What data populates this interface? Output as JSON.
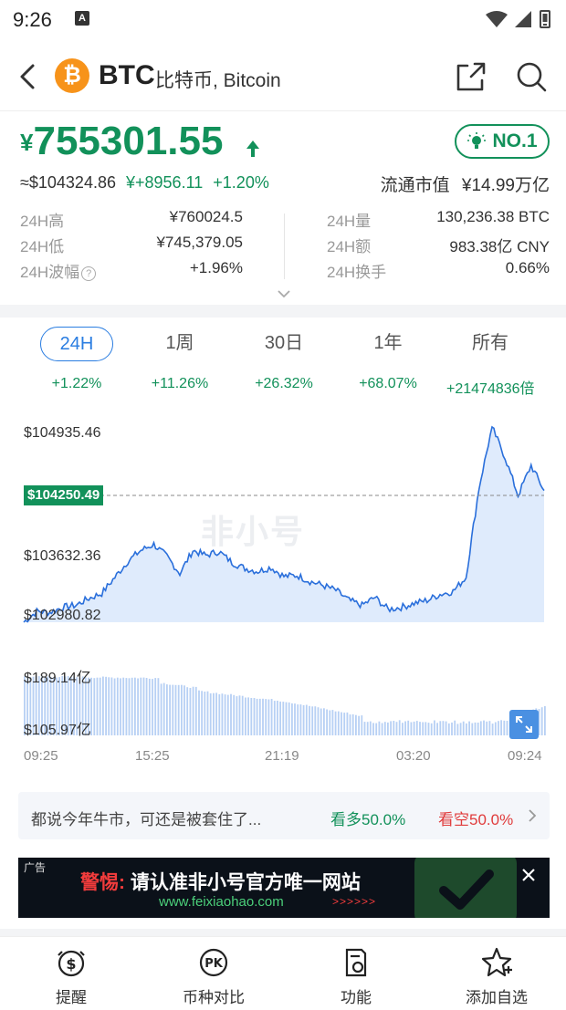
{
  "status_bar": {
    "time": "9:26",
    "notif_letter": "A"
  },
  "header": {
    "symbol": "BTC",
    "name": "比特币, Bitcoin",
    "logo_glyph": "₿",
    "icons": [
      "back-icon",
      "share-icon",
      "search-icon"
    ]
  },
  "price": {
    "currency_symbol": "¥",
    "value": "755301.55",
    "usd_value": "≈$104324.86",
    "change_value": "¥+8956.11",
    "change_percent": "+1.20%",
    "rank": "NO.1",
    "market_cap_label": "流通市值",
    "market_cap_value": "¥14.99万亿",
    "up_color": "#12915a"
  },
  "stats": {
    "left": [
      {
        "label": "24H高",
        "value": "¥760024.5"
      },
      {
        "label": "24H低",
        "value": "¥745,379.05"
      },
      {
        "label": "24H波幅",
        "value": "+1.96%",
        "help": "?"
      }
    ],
    "right": [
      {
        "label": "24H量",
        "value": "130,236.38 BTC"
      },
      {
        "label": "24H额",
        "value": "983.38亿 CNY"
      },
      {
        "label": "24H换手",
        "value": "0.66%"
      }
    ]
  },
  "tabs": [
    {
      "label": "24H",
      "change": "+1.22%",
      "active": true
    },
    {
      "label": "1周",
      "change": "+11.26%"
    },
    {
      "label": "30日",
      "change": "+26.32%"
    },
    {
      "label": "1年",
      "change": "+68.07%"
    },
    {
      "label": "所有",
      "change": "+21474836倍"
    }
  ],
  "chart": {
    "y_labels": [
      "$104935.46",
      "$103632.36",
      "$102980.82"
    ],
    "current_price_label": "$104250.49",
    "volume_labels": [
      "$189.14亿",
      "$105.97亿"
    ],
    "x_labels": [
      "09:25",
      "15:25",
      "21:19",
      "03:20",
      "09:24"
    ],
    "watermark": "非小号",
    "line_color": "#2a6fdb",
    "fill_color": "#d7e6fb"
  },
  "chart_data": {
    "type": "area",
    "x": [
      "09:25",
      "15:25",
      "21:19",
      "03:20",
      "09:24"
    ],
    "values": [
      102981,
      103090,
      103080,
      103130,
      103150,
      103220,
      103270,
      103430,
      103590,
      103700,
      103760,
      103640,
      103470,
      103700,
      103650,
      103690,
      103580,
      103520,
      103490,
      103530,
      103440,
      103450,
      103390,
      103350,
      103300,
      103200,
      103150,
      103230,
      103110,
      103130,
      103170,
      103200,
      103260,
      103290,
      103430,
      104330,
      104935,
      104630,
      104250,
      104550,
      104300
    ],
    "current_price": 104250.49,
    "ylim": [
      102980.82,
      104935.46
    ],
    "volume": {
      "type": "bar",
      "ylim": [
        105.97,
        189.14
      ],
      "unit": "亿"
    }
  },
  "sentiment": {
    "text": "都说今年牛市，可还是被套住了...",
    "bull": "看多50.0%",
    "bear": "看空50.0%"
  },
  "ad": {
    "tag": "广告",
    "warn": "警惕:",
    "title": "请认准非小号官方唯一网站",
    "url": "www.feixiaohao.com",
    "arrows": ">>>>>>"
  },
  "bottom_nav": [
    {
      "label": "提醒",
      "icon": "alarm-dollar-icon"
    },
    {
      "label": "币种对比",
      "icon": "pk-compare-icon"
    },
    {
      "label": "功能",
      "icon": "function-doc-icon"
    },
    {
      "label": "添加自选",
      "icon": "star-add-icon"
    }
  ]
}
